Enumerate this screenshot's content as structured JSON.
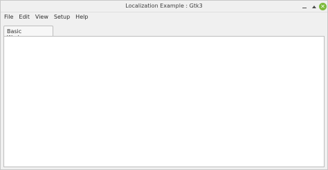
{
  "window": {
    "title": "Localization Example : Gtk3",
    "close_glyph": "✕"
  },
  "menu": {
    "items": [
      "File",
      "Edit",
      "View",
      "Setup",
      "Help"
    ]
  },
  "tabs": [
    {
      "label": "Basic Workspace",
      "selected": true
    }
  ],
  "icons": {
    "minimize": "minimize-icon",
    "maximize": "maximize-icon",
    "close": "close-icon"
  },
  "colors": {
    "close_button": "#7cba3a"
  }
}
